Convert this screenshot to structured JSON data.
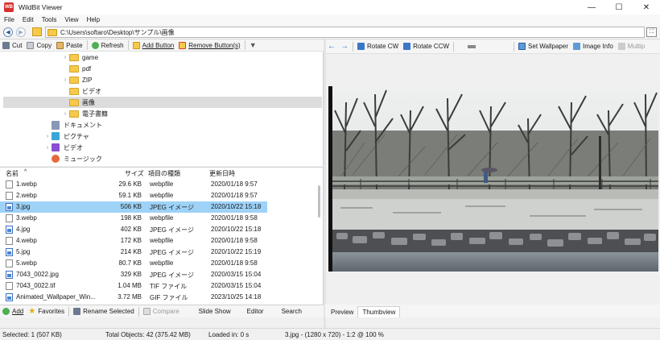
{
  "window": {
    "title": "WildBit Viewer",
    "minimize": "—",
    "maximize": "☐",
    "close": "✕",
    "app_icon": "WB"
  },
  "menu": [
    "File",
    "Edit",
    "Tools",
    "View",
    "Help"
  ],
  "address": {
    "path": "C:\\Users\\softaro\\Desktop\\サンプル\\画像"
  },
  "left_toolbar": {
    "cut": "Cut",
    "copy": "Copy",
    "paste": "Paste",
    "refresh": "Refresh",
    "add_button": "Add Button",
    "remove_button": "Remove Button(s)"
  },
  "right_toolbar": {
    "rotate_cw": "Rotate CW",
    "rotate_ccw": "Rotate CCW",
    "set_wallpaper": "Set Wallpaper",
    "image_info": "Image Info",
    "multiple": "Multip"
  },
  "tree": [
    {
      "label": "game",
      "expander": "›",
      "icon": "folder"
    },
    {
      "label": "pdf",
      "expander": "",
      "icon": "folder"
    },
    {
      "label": "ZIP",
      "expander": "›",
      "icon": "folder"
    },
    {
      "label": "ビデオ",
      "expander": "",
      "icon": "folder"
    },
    {
      "label": "画像",
      "expander": "",
      "icon": "folder",
      "selected": true
    },
    {
      "label": "電子書籍",
      "expander": "›",
      "icon": "folder"
    },
    {
      "label": "ドキュメント",
      "expander": "",
      "icon": "doc"
    },
    {
      "label": "ピクチャ",
      "expander": "›",
      "icon": "pic"
    },
    {
      "label": "ビデオ",
      "expander": "›",
      "icon": "vid"
    },
    {
      "label": "ミュージック",
      "expander": "",
      "icon": "mus"
    }
  ],
  "filelist": {
    "headers": {
      "name": "名前",
      "size": "サイズ",
      "type": "項目の種類",
      "date": "更新日時",
      "sort_arrow": "^"
    },
    "rows": [
      {
        "name": "1.webp",
        "size": "29.6 KB",
        "type": "webpfile",
        "date": "2020/01/18 9:57",
        "icon": "file"
      },
      {
        "name": "2.webp",
        "size": "59.1 KB",
        "type": "webpfile",
        "date": "2020/01/18 9:57",
        "icon": "file"
      },
      {
        "name": "3.jpg",
        "size": "506 KB",
        "type": "JPEG イメージ",
        "date": "2020/10/22 15:18",
        "icon": "img",
        "selected": true
      },
      {
        "name": "3.webp",
        "size": "198 KB",
        "type": "webpfile",
        "date": "2020/01/18 9:58",
        "icon": "file"
      },
      {
        "name": "4.jpg",
        "size": "402 KB",
        "type": "JPEG イメージ",
        "date": "2020/10/22 15:18",
        "icon": "img"
      },
      {
        "name": "4.webp",
        "size": "172 KB",
        "type": "webpfile",
        "date": "2020/01/18 9:58",
        "icon": "file"
      },
      {
        "name": "5.jpg",
        "size": "214 KB",
        "type": "JPEG イメージ",
        "date": "2020/10/22 15:19",
        "icon": "img"
      },
      {
        "name": "5.webp",
        "size": "80.7 KB",
        "type": "webpfile",
        "date": "2020/01/18 9:58",
        "icon": "file"
      },
      {
        "name": "7043_0022.jpg",
        "size": "329 KB",
        "type": "JPEG イメージ",
        "date": "2020/03/15 15:04",
        "icon": "img"
      },
      {
        "name": "7043_0022.tif",
        "size": "1.04 MB",
        "type": "TIF ファイル",
        "date": "2020/03/15 15:04",
        "icon": "file"
      },
      {
        "name": "Animated_Wallpaper_Win...",
        "size": "3.72 MB",
        "type": "GIF ファイル",
        "date": "2023/10/25 14:18",
        "icon": "img"
      }
    ]
  },
  "bottom_toolbar": {
    "add": "Add",
    "favorites": "Favorites",
    "rename_selected": "Rename Selected",
    "compare": "Compare",
    "slide_show": "Slide Show",
    "editor": "Editor",
    "search": "Search"
  },
  "tabs": [
    "Preview",
    "Thumbview"
  ],
  "status": {
    "selected": "Selected: 1 (507 KB)",
    "total": "Total Objects: 42 (375.42 MB)",
    "loaded": "Loaded in: 0 s",
    "image": "3.jpg - (1280 x 720) - 1:2 @ 100 %"
  },
  "colors": {
    "accent": "#9ed2f7",
    "app_icon": "#d6312c",
    "folder": "#f6c94a"
  }
}
